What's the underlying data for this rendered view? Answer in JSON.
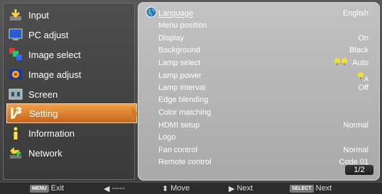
{
  "menu": {
    "items": [
      {
        "label": "Input",
        "icon": "input-arrow-icon"
      },
      {
        "label": "PC adjust",
        "icon": "monitor-icon"
      },
      {
        "label": "Image select",
        "icon": "image-select-icon"
      },
      {
        "label": "Image adjust",
        "icon": "image-adjust-icon"
      },
      {
        "label": "Screen",
        "icon": "screen-icon"
      },
      {
        "label": "Setting",
        "icon": "wrench-icon"
      },
      {
        "label": "Information",
        "icon": "info-icon"
      },
      {
        "label": "Network",
        "icon": "network-icon"
      }
    ],
    "active_index": 5
  },
  "settings": {
    "rows": [
      {
        "label": "Language",
        "value": "English"
      },
      {
        "label": "Menu position",
        "value": ""
      },
      {
        "label": "Display",
        "value": "On"
      },
      {
        "label": "Background",
        "value": "Black"
      },
      {
        "label": "Lamp select",
        "value": "Auto"
      },
      {
        "label": "Lamp power",
        "value": ""
      },
      {
        "label": "Lamp interval",
        "value": "Off"
      },
      {
        "label": "Edge blending",
        "value": ""
      },
      {
        "label": "Color matching",
        "value": ""
      },
      {
        "label": "HDMI setup",
        "value": "Normal"
      },
      {
        "label": "Logo",
        "value": ""
      },
      {
        "label": "Fan control",
        "value": "Normal"
      },
      {
        "label": "Remote control",
        "value": "Code 01"
      }
    ],
    "lamp_power_sub": "A",
    "page": "1/2"
  },
  "footer": {
    "menu_key": "MENU",
    "exit": "Exit",
    "back_dashes": "-----",
    "move": "Move",
    "next_arrow_label": "Next",
    "select_key": "SELECT",
    "select_next": "Next"
  },
  "colors": {
    "active_item": "#d6782a",
    "panel_bg": "#b8b8b8",
    "lamp_yellow": "#f2e030"
  }
}
